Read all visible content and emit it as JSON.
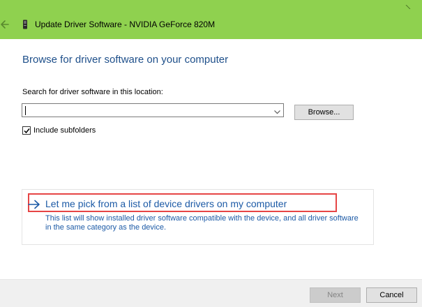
{
  "window": {
    "title": "Update Driver Software - NVIDIA GeForce 820M",
    "back_icon": "back-arrow-icon",
    "device_icon": "device-icon",
    "titlebar_color": "#8fd14f"
  },
  "main": {
    "heading": "Browse for driver software on your computer",
    "heading_color": "#1e4f8a",
    "search_label": "Search for driver software in this location:",
    "path_input": {
      "value": "",
      "placeholder": ""
    },
    "browse_label": "Browse...",
    "include_subfolders": {
      "label": "Include subfolders",
      "checked": true
    }
  },
  "pick_option": {
    "title": "Let me pick from a list of device drivers on my computer",
    "description": "This list will show installed driver software compatible with the device, and all driver software in the same category as the device.",
    "link_color": "#1c5aa6",
    "highlight_color": "#e64545",
    "arrow_icon": "arrow-right-icon"
  },
  "footer": {
    "next_label": "Next",
    "next_enabled": false,
    "cancel_label": "Cancel"
  }
}
